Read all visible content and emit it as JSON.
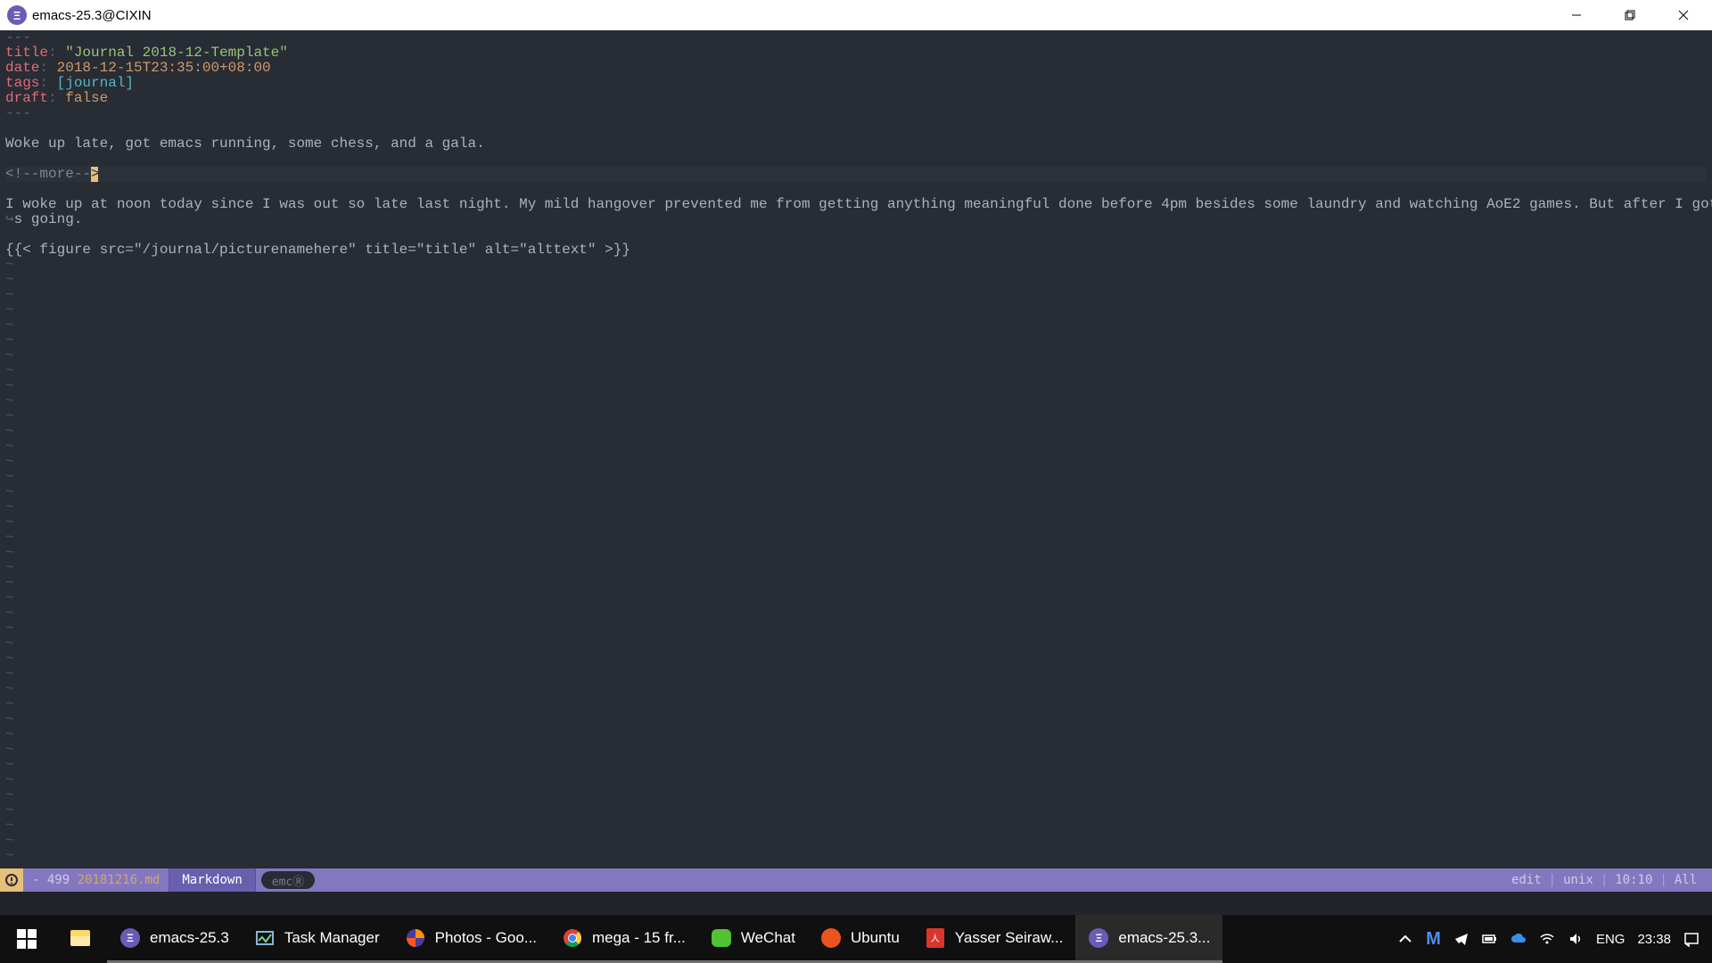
{
  "titlebar": {
    "title": "emacs-25.3@CIXIN"
  },
  "editor": {
    "front_top": "---",
    "title_key": "title",
    "title_val": "\"Journal 2018-12-Template\"",
    "date_key": "date",
    "date_val": "2018-12-15T23:35:00+08:00",
    "tags_key": "tags",
    "tags_val": "[journal]",
    "draft_key": "draft",
    "draft_val": "false",
    "front_bot": "---",
    "summary": "Woke up late, got emacs running, some chess, and a gala.",
    "more_open": "<!--",
    "more_body": "more--",
    "body1": "I woke up at noon today since I was out so late last night. My mild hangover prevented me from getting anything meaningful done before 4pm besides some laundry and watching AoE2 games. But after I got my tea and some McDonalds, I got emac",
    "wrap_marker": "➤",
    "body2": "s going.",
    "shortcode": "{{< figure src=\"/journal/picturenamehere\" title=\"title\" alt=\"alttext\" >}}"
  },
  "modeline": {
    "dash": "-",
    "line_number": "499",
    "filename": "20181216.md",
    "major_mode": "Markdown",
    "minor_mode": "emcⓇ",
    "edit": "edit",
    "encoding": "unix",
    "position": "10:10",
    "scroll": "All"
  },
  "taskbar": {
    "items": [
      {
        "label": "",
        "icon": "folder"
      },
      {
        "label": "emacs-25.3",
        "icon": "emacs"
      },
      {
        "label": "Task Manager",
        "icon": "taskmgr"
      },
      {
        "label": "Photos - Goo...",
        "icon": "firefox"
      },
      {
        "label": "mega - 15 fr...",
        "icon": "chrome"
      },
      {
        "label": "WeChat",
        "icon": "wechat"
      },
      {
        "label": "Ubuntu",
        "icon": "ubuntu"
      },
      {
        "label": "Yasser Seiraw...",
        "icon": "pdf"
      },
      {
        "label": "emacs-25.3...",
        "icon": "emacs",
        "active": true
      }
    ],
    "lang": "ENG",
    "time": "23:38"
  }
}
